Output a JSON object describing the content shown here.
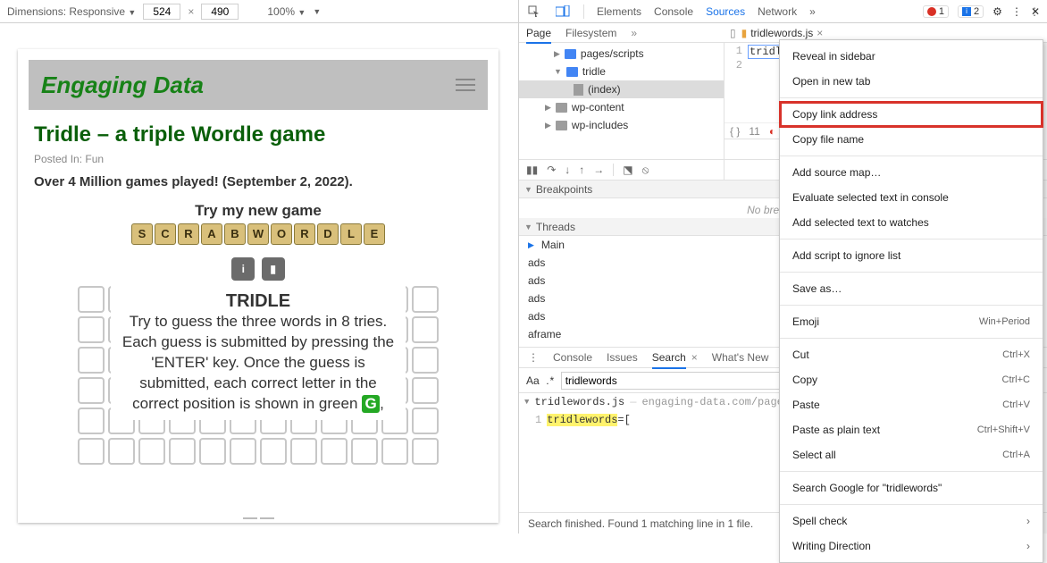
{
  "toolbar": {
    "dimensions_label": "Dimensions: Responsive",
    "width": "524",
    "height": "490",
    "zoom": "100%"
  },
  "devtools_tabs": {
    "elements": "Elements",
    "console": "Console",
    "sources": "Sources",
    "network": "Network",
    "errors": "1",
    "messages": "2"
  },
  "sources_subtabs": {
    "page": "Page",
    "filesystem": "Filesystem"
  },
  "file_tab": {
    "name": "tridlewords.js"
  },
  "tree": {
    "pages_scripts": "pages/scripts",
    "tridle": "tridle",
    "index": "(index)",
    "wp_content": "wp-content",
    "wp_includes": "wp-includes"
  },
  "code": {
    "line1_no": "1",
    "line2_no": "2",
    "line1": "tridlewords=["
  },
  "gutter": {
    "count": "11"
  },
  "breakpoints": {
    "title": "Breakpoints",
    "none": "No breakpoints"
  },
  "threads": {
    "title": "Threads",
    "main": "Main",
    "ads": "ads",
    "aframe": "aframe"
  },
  "bottom_tabs": {
    "console": "Console",
    "issues": "Issues",
    "search": "Search",
    "whats_new": "What's New"
  },
  "search": {
    "query": "tridlewords",
    "result_file": "tridlewords.js",
    "result_path": "engaging-data.com/pages/scripts",
    "result_lineno": "1",
    "result_word": "tridlewords",
    "result_rest": "=[",
    "status": "Search finished. Found 1 matching line in 1 file."
  },
  "site": {
    "title": "Engaging Data",
    "article_title": "Tridle – a triple Wordle game",
    "posted_in_label": "Posted In:",
    "posted_in_value": "Fun",
    "milestone": "Over 4 Million games played! (September 2, 2022).",
    "try_line": "Try my new game",
    "tiles": [
      "S",
      "C",
      "R",
      "A",
      "B",
      "W",
      "O",
      "R",
      "D",
      "L",
      "E"
    ],
    "overlay_title": "TRIDLE",
    "overlay_l1": "Try to guess the three words in 8 tries.",
    "overlay_l2": "Each guess is submitted by pressing the 'ENTER' key. Once the guess is submitted, each correct letter in the correct position is shown in green",
    "g": "G"
  },
  "ctx": {
    "reveal": "Reveal in sidebar",
    "open_tab": "Open in new tab",
    "copy_link": "Copy link address",
    "copy_file": "Copy file name",
    "add_map": "Add source map…",
    "eval": "Evaluate selected text in console",
    "watch": "Add selected text to watches",
    "ignore": "Add script to ignore list",
    "save_as": "Save as…",
    "emoji": "Emoji",
    "emoji_sc": "Win+Period",
    "cut": "Cut",
    "cut_sc": "Ctrl+X",
    "copy": "Copy",
    "copy_sc": "Ctrl+C",
    "paste": "Paste",
    "paste_sc": "Ctrl+V",
    "paste_plain": "Paste as plain text",
    "paste_plain_sc": "Ctrl+Shift+V",
    "select_all": "Select all",
    "select_all_sc": "Ctrl+A",
    "google": "Search Google for \"tridlewords\"",
    "spell": "Spell check",
    "writing": "Writing Direction"
  },
  "misc": {
    "d": "D",
    "aa": "Aa",
    "dotstar": ".*"
  }
}
